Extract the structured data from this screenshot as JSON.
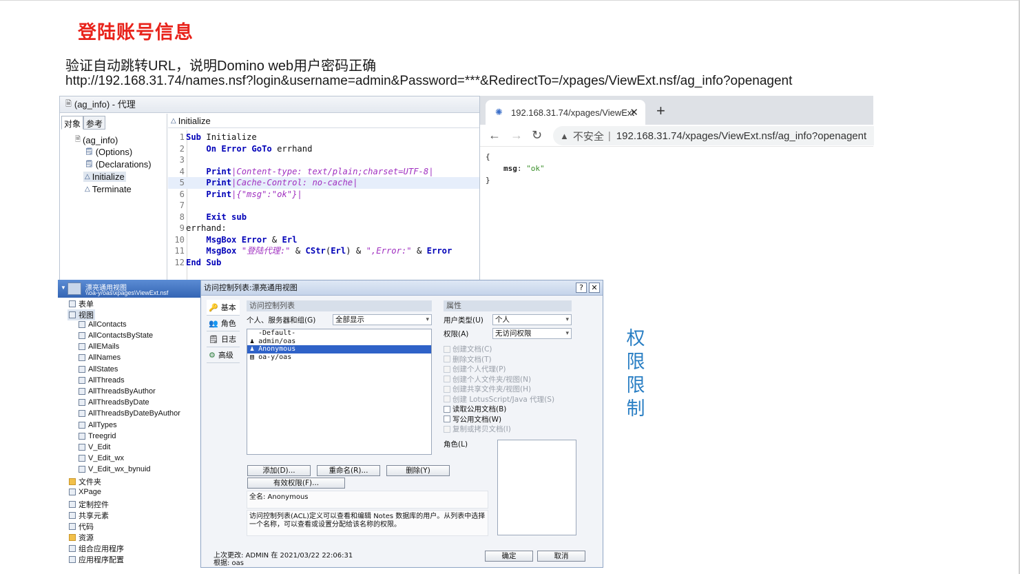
{
  "slide": {
    "title": "登陆账号信息",
    "desc1": "验证自动跳转URL，说明Domino web用户密码正确",
    "desc2": "http://192.168.31.74/names.nsf?login&username=admin&Password=***&RedirectTo=/xpages/ViewExt.nsf/ag_info?openagent",
    "vertical_chars": [
      "权",
      "限",
      "限",
      "制"
    ]
  },
  "agent_editor": {
    "title": "(ag_info) - 代理",
    "tabs": [
      "对象",
      "参考"
    ],
    "tree": [
      "(ag_info)",
      "(Options)",
      "(Declarations)",
      "Initialize",
      "Terminate"
    ],
    "code_header": "Initialize",
    "line_numbers": [
      "1",
      "2",
      "3",
      "4",
      "5",
      "6",
      "7",
      "8",
      "9",
      "10",
      "11",
      "12"
    ],
    "code": {
      "l1_kw": "Sub",
      "l1_rest": " Initialize",
      "l2_kw": "On Error GoTo",
      "l2_rest": " errhand",
      "l4_kw": "Print",
      "l4_str": "|Content-type: text/plain;charset=UTF-8|",
      "l5_kw": "Print",
      "l5_str": "|Cache-Control: no-cache|",
      "l6_kw": "Print",
      "l6_str": "|{\"msg\":\"ok\"}|",
      "l8_kw": "Exit sub",
      "l9_rest": "errhand:",
      "l10_kw": "MsgBox Error",
      "l10_mid": " & ",
      "l10_kw2": "Erl",
      "l11_kw": "MsgBox",
      "l11_str1": " \"登陆代理:\"",
      "l11_mid": " & ",
      "l11_kw2": "CStr",
      "l11_paren1": "(",
      "l11_kw3": "Erl",
      "l11_paren2": ")",
      "l11_mid2": " & ",
      "l11_str2": "\",Error:\"",
      "l11_mid3": " & ",
      "l11_kw4": "Error",
      "l12_kw": "End Sub"
    }
  },
  "browser": {
    "tab_title": "192.168.31.74/xpages/ViewExt",
    "insecure_label": "不安全",
    "separator": "|",
    "url": "192.168.31.74/xpages/ViewExt.nsf/ag_info?openagent",
    "json_open": "{",
    "json_key": "msg",
    "json_colon": ": ",
    "json_value": "\"ok\"",
    "json_close": "}"
  },
  "designer": {
    "db_title": "漂亮通用视图",
    "db_path": "\\\\oa-y/oas\\xpages\\ViewExt.nsf",
    "items": [
      "表单",
      "视图",
      "AllContacts",
      "AllContactsByState",
      "AllEMails",
      "AllNames",
      "AllStates",
      "AllThreads",
      "AllThreadsByAuthor",
      "AllThreadsByDate",
      "AllThreadsByDateByAuthor",
      "AllTypes",
      "Treegrid",
      "V_Edit",
      "V_Edit_wx",
      "V_Edit_wx_bynuid",
      "文件夹",
      "XPage",
      "定制控件",
      "共享元素",
      "代码",
      "资源",
      "组合应用程序",
      "应用程序配置"
    ]
  },
  "acl_dialog": {
    "title": "访问控制列表:漂亮通用视图",
    "help_btn": "?",
    "close_btn": "✕",
    "side_tabs": [
      "基本",
      "角色",
      "日志",
      "高级"
    ],
    "acl_section": "访问控制列表",
    "people_label": "个人、服务器和组(G)",
    "people_filter": "全部显示",
    "entries": [
      "-Default-",
      "admin/oas",
      "Anonymous",
      "oa-y/oas"
    ],
    "selected_entry": "Anonymous",
    "attr_section": "属性",
    "user_type_label": "用户类型(U)",
    "user_type_value": "个人",
    "access_label": "权限(A)",
    "access_value": "无访问权限",
    "checkboxes": [
      {
        "label": "创建文档(C)",
        "disabled": true
      },
      {
        "label": "删除文档(T)",
        "disabled": true
      },
      {
        "label": "创建个人代理(P)",
        "disabled": true
      },
      {
        "label": "创建个人文件夹/视图(N)",
        "disabled": true
      },
      {
        "label": "创建共享文件夹/视图(H)",
        "disabled": true
      },
      {
        "label": "创建 LotusScript/Java 代理(S)",
        "disabled": true
      },
      {
        "label": "读取公用文档(B)",
        "disabled": false
      },
      {
        "label": "写公用文档(W)",
        "disabled": false
      },
      {
        "label": "复制或拷贝文档(I)",
        "disabled": true
      }
    ],
    "roles_label": "角色(L)",
    "add_btn": "添加(D)...",
    "rename_btn": "重命名(R)...",
    "delete_btn": "删除(Y)",
    "effective_btn": "有效权限(F)...",
    "fullname": "全名: Anonymous",
    "info_text": "访问控制列表(ACL)定义可以查看和编辑 Notes 数据库的用户。从列表中选择一个名称，可以查看或设置分配给该名称的权限。",
    "last_change": "上次更改: ADMIN 在 2021/03/22 22:06:31",
    "basis": "根据: oas",
    "ok_btn": "确定",
    "cancel_btn": "取消"
  }
}
